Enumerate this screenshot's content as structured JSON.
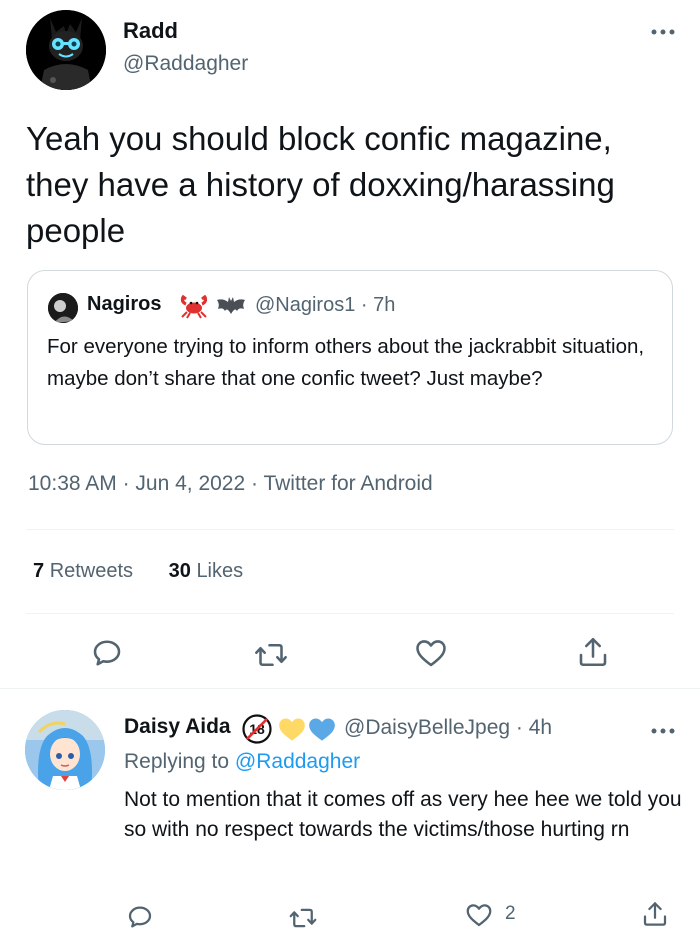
{
  "tweet": {
    "name": "Radd",
    "handle": "@Raddagher",
    "text": "Yeah you should block confic magazine, they have a history of doxxing/harassing people",
    "quote": {
      "name": "Nagiros",
      "handle_time": "@Nagiros1 · 7h",
      "text": "For everyone trying to inform others about the jackrabbit situation, maybe don’t share that one confic tweet? Just maybe?"
    },
    "time": "10:38 AM",
    "date": "Jun 4, 2022",
    "client": "Twitter for Android",
    "retweets_count": "7",
    "retweets_label": "Retweets",
    "likes_count": "30",
    "likes_label": "Likes",
    "actions": [
      "reply-icon",
      "retweet-icon",
      "like-icon",
      "share-icon"
    ]
  },
  "reply": {
    "name": "Daisy Aida",
    "badge": "18",
    "handle_time": "@DaisyBelleJpeg · 4h",
    "replying_label": "Replying to",
    "replying_to": "@Raddagher",
    "text": "Not to mention that it comes off as very hee hee we told you so with no respect towards the victims/those hurting rn",
    "like_count": "2"
  },
  "colors": {
    "text": "#0f1419",
    "secondary": "#536471",
    "link": "#1d9bf0",
    "border": "#cfd9de",
    "heart_yellow": "#ffd966",
    "heart_blue": "#5aa9e6"
  }
}
